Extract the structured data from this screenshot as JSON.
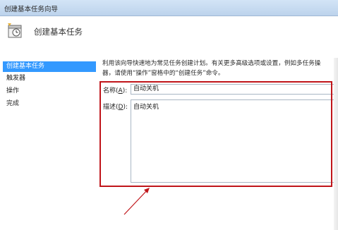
{
  "window": {
    "title": "创建基本任务向导"
  },
  "header": {
    "title": "创建基本任务",
    "icon": "task-wizard-icon"
  },
  "sidebar": {
    "items": [
      {
        "label": "创建基本任务",
        "active": true
      },
      {
        "label": "触发器",
        "active": false
      },
      {
        "label": "操作",
        "active": false
      },
      {
        "label": "完成",
        "active": false
      }
    ]
  },
  "main": {
    "intro_line1": "利用该向导快速地为常见任务创建计划。有关更多高级选项或设置，例如多任务操",
    "intro_line2": "器，请使用“操作”窗格中的“创建任务”命令。",
    "name_label": "名称",
    "name_mnemonic": "A",
    "name_value": "自动关机",
    "desc_label": "描述",
    "desc_mnemonic": "D",
    "desc_value": "自动关机"
  },
  "annotation": {
    "highlight_color": "#c0151a"
  }
}
